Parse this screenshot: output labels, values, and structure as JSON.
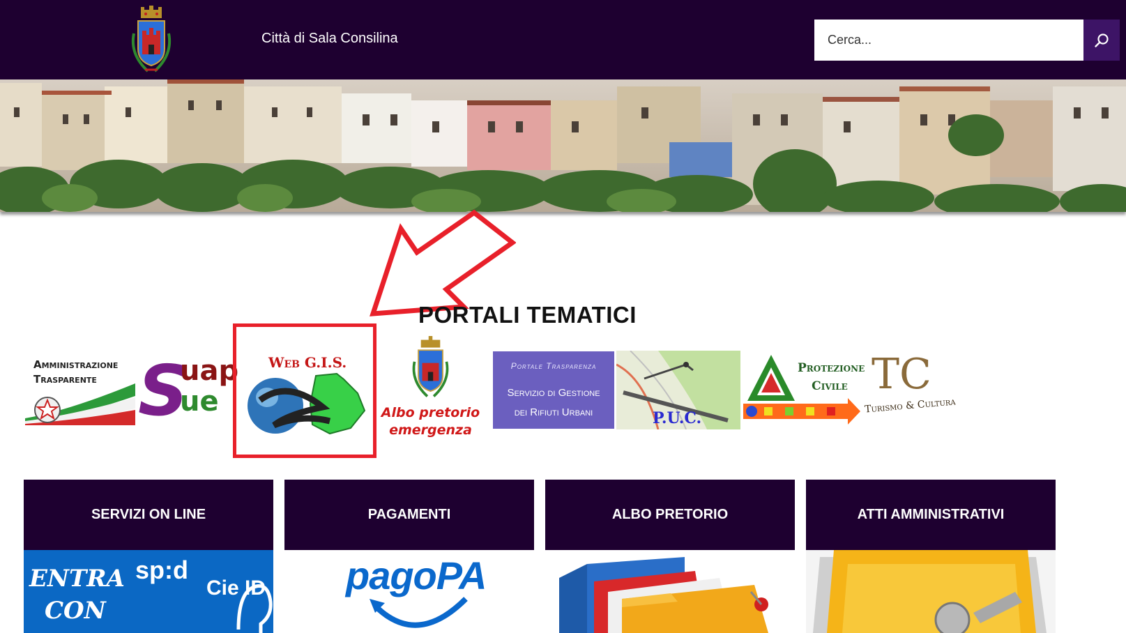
{
  "header": {
    "site_title": "Città di Sala Consilina",
    "search_placeholder": "Cerca...",
    "bg_color": "#1e0030"
  },
  "section": {
    "title": "PORTALI TEMATICI"
  },
  "portals": {
    "amministrazione": {
      "line1": "Amministrazione",
      "line2": "Trasparente"
    },
    "suap": {
      "label": "Suap Sue"
    },
    "webgis": {
      "title": "Web G.I.S."
    },
    "albo_emergenza": {
      "line1": "Albo pretorio",
      "line2": "emergenza"
    },
    "trasparenza": {
      "line1": "Portale Trasparenza",
      "line2": "Servizio di Gestione",
      "line3": "dei Rifiuti Urbani"
    },
    "puc": {
      "label": "P.U.C."
    },
    "protezione": {
      "line1": "Protezione",
      "line2": "Civile"
    },
    "turismo": {
      "logo": "TC",
      "label": "Turismo & Cultura"
    }
  },
  "cards": [
    {
      "title": "SERVIZI ON LINE",
      "img_line1": "ENTRA",
      "img_line2": "CON",
      "spid": "sp:d",
      "cie": "Cie ID"
    },
    {
      "title": "PAGAMENTI",
      "img_text": "pagoPA"
    },
    {
      "title": "ALBO PRETORIO"
    },
    {
      "title": "ATTI AMMINISTRATIVI"
    }
  ],
  "icons": {
    "search": "search-icon",
    "crest": "city-crest-icon"
  },
  "colors": {
    "accent": "#3d1466",
    "annotation": "#e8202a",
    "spid_blue": "#0b68c4"
  }
}
